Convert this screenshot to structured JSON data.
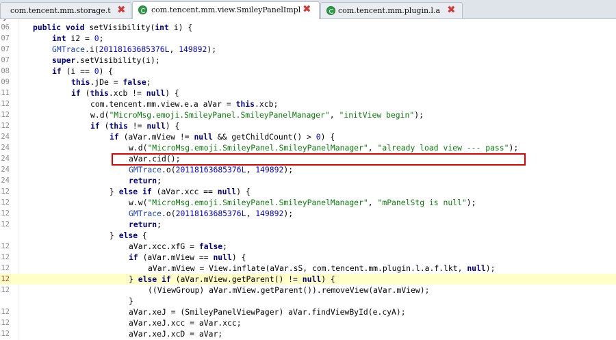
{
  "tabs": [
    {
      "label": "com.tencent.mm.storage.t",
      "active": false
    },
    {
      "label": "com.tencent.mm.view.SmileyPanelImpl",
      "active": true
    },
    {
      "label": "com.tencent.mm.plugin.l.a",
      "active": false
    }
  ],
  "tab_close_glyph": "✖",
  "lines": [
    {
      "n": "",
      "code": "}"
    },
    {
      "n": "06",
      "code": "public void setVisibility(int i) {"
    },
    {
      "n": "07",
      "code": "int i2 = 0;"
    },
    {
      "n": "07",
      "code": "GMTrace.i(20118163685376L, 149892);"
    },
    {
      "n": "07",
      "code": "super.setVisibility(i);"
    },
    {
      "n": "08",
      "code": "if (i == 0) {"
    },
    {
      "n": "09",
      "code": "this.jDe = false;"
    },
    {
      "n": "11",
      "code": "if (this.xcb != null) {"
    },
    {
      "n": "12",
      "code": "com.tencent.mm.view.e.a aVar = this.xcb;"
    },
    {
      "n": "12",
      "code": "w.d(\"MicroMsg.emoji.SmileyPanel.SmileyPanelManager\", \"initView begin\");"
    },
    {
      "n": "12",
      "code": "if (this != null) {"
    },
    {
      "n": "24",
      "code": "if (aVar.mView != null && getChildCount() > 0) {"
    },
    {
      "n": "24",
      "code": "w.d(\"MicroMsg.emoji.SmileyPanel.SmileyPanelManager\", \"already load view --- pass\");"
    },
    {
      "n": "24",
      "code": "aVar.cid();"
    },
    {
      "n": "24",
      "code": "GMTrace.o(20118163685376L, 149892);"
    },
    {
      "n": "24",
      "code": "return;"
    },
    {
      "n": "12",
      "code": "} else if (aVar.xcc == null) {"
    },
    {
      "n": "12",
      "code": "w.w(\"MicroMsg.emoji.SmileyPanel.SmileyPanelManager\", \"mPanelStg is null\");"
    },
    {
      "n": "12",
      "code": "GMTrace.o(20118163685376L, 149892);"
    },
    {
      "n": "12",
      "code": "return;"
    },
    {
      "n": "",
      "code": "} else {"
    },
    {
      "n": "12",
      "code": "aVar.xcc.xfG = false;"
    },
    {
      "n": "12",
      "code": "if (aVar.mView == null) {"
    },
    {
      "n": "12",
      "code": "aVar.mView = View.inflate(aVar.sS, com.tencent.mm.plugin.l.a.f.lkt, null);"
    },
    {
      "n": "12",
      "code": "} else if (aVar.mView.getParent() != null) {"
    },
    {
      "n": "12",
      "code": "((ViewGroup) aVar.mView.getParent()).removeView(aVar.mView);"
    },
    {
      "n": "",
      "code": "}"
    },
    {
      "n": "12",
      "code": "aVar.xeJ = (SmileyPanelViewPager) aVar.findViewById(e.cyA);"
    },
    {
      "n": "12",
      "code": "aVar.xeJ.xcc = aVar.xcc;"
    },
    {
      "n": "12",
      "code": "aVar.xeJ.xcD = aVar;"
    }
  ],
  "highlighted_line_index": 24,
  "boxed_line_index": 12
}
